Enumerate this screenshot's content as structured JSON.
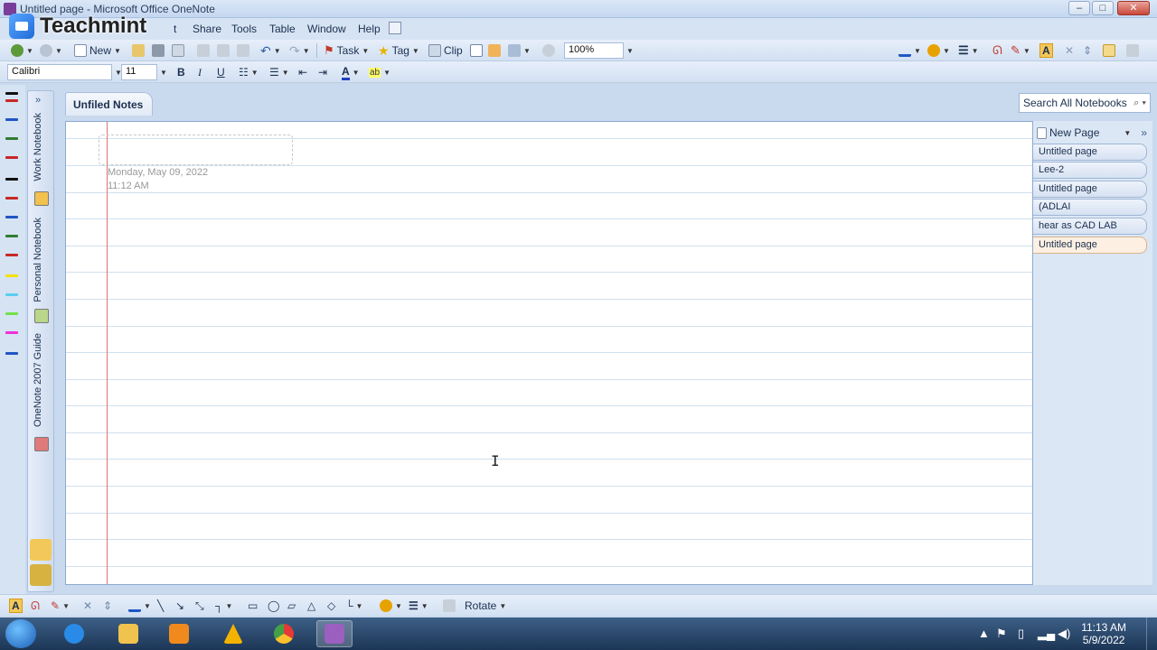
{
  "window": {
    "title": "Untitled page - Microsoft Office OneNote",
    "minimize": "–",
    "maximize": "□",
    "close": "✕"
  },
  "logo": {
    "text": "Teachmint"
  },
  "menu": {
    "items": [
      {
        "label": "t"
      },
      {
        "label": "Share"
      },
      {
        "label": "Tools"
      },
      {
        "label": "Table"
      },
      {
        "label": "Window"
      },
      {
        "label": "Help"
      }
    ]
  },
  "toolbar": {
    "new_label": "New",
    "task_label": "Task",
    "tag_label": "Tag",
    "clip_label": "Clip",
    "zoom": "100%"
  },
  "format": {
    "font": "Calibri",
    "size": "11",
    "bold": "B",
    "italic": "I",
    "underline": "U",
    "font_color": "A"
  },
  "notebooks": [
    {
      "label": "Work Notebook",
      "color": "#f2c14e"
    },
    {
      "label": "Personal Notebook",
      "color": "#b9d68a"
    },
    {
      "label": "OneNote 2007 Guide",
      "color": "#e07a7a"
    }
  ],
  "section": {
    "label": "Unfiled Notes"
  },
  "search": {
    "placeholder": "Search All Notebooks"
  },
  "page": {
    "date": "Monday, May 09, 2022",
    "time": "11:12 AM"
  },
  "pages_panel": {
    "new_page_label": "New Page",
    "pages": [
      {
        "label": "Untitled page"
      },
      {
        "label": "Lee-2"
      },
      {
        "label": "Untitled page"
      },
      {
        "label": "(ADLAI"
      },
      {
        "label": "hear as CAD LAB"
      },
      {
        "label": "Untitled page"
      }
    ]
  },
  "drawbar": {
    "rotate_label": "Rotate"
  },
  "taskbar": {
    "time": "11:13 AM",
    "date": "5/9/2022"
  },
  "colors": {
    "accent": "#1f6ad8",
    "margin": "#e07070",
    "rule": "#cfe0ee"
  }
}
